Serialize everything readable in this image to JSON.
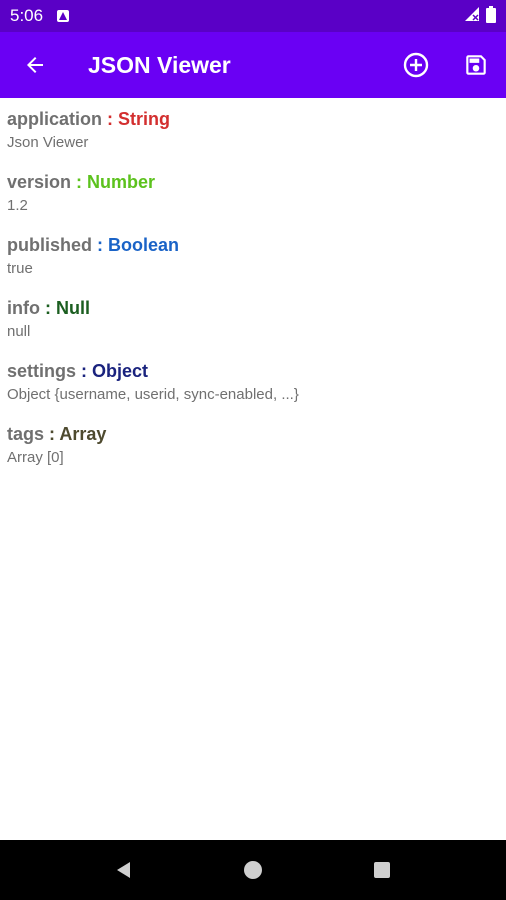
{
  "status_bar": {
    "time": "5:06",
    "icons": [
      "notification-icon",
      "signal-icon",
      "battery-icon"
    ]
  },
  "app_bar": {
    "title": "JSON Viewer",
    "icons": [
      "back-arrow-icon",
      "add-circle-icon",
      "save-icon"
    ]
  },
  "items": [
    {
      "key": "application",
      "separator": " : ",
      "type": "String",
      "type_color": "#d32f2f",
      "value": "Json Viewer"
    },
    {
      "key": "version",
      "separator": " : ",
      "type": "Number",
      "type_color": "#5cc21d",
      "value": "1.2"
    },
    {
      "key": "published",
      "separator": " : ",
      "type": "Boolean",
      "type_color": "#1a63c7",
      "value": "true"
    },
    {
      "key": "info",
      "separator": " : ",
      "type": "Null",
      "type_color": "#1b5e20",
      "value": "null"
    },
    {
      "key": "settings",
      "separator": " : ",
      "type": "Object",
      "type_color": "#1a237e",
      "value": "Object {username, userid, sync-enabled, ...}"
    },
    {
      "key": "tags",
      "separator": " : ",
      "type": "Array",
      "type_color": "#4e4a2f",
      "value": "Array [0]"
    }
  ],
  "nav_bar": {
    "icons": [
      "back-triangle-icon",
      "home-circle-icon",
      "recents-square-icon"
    ]
  },
  "colors": {
    "status_bar": "#5a00c6",
    "app_bar": "#6a00f4",
    "text_gray": "#707070"
  }
}
